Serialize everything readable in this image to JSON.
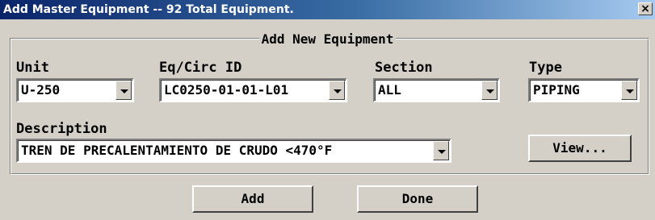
{
  "window": {
    "title": "Add Master Equipment -- 92 Total Equipment.",
    "close_glyph": "×"
  },
  "group": {
    "legend": "Add New Equipment"
  },
  "fields": {
    "unit": {
      "label": "Unit",
      "value": "U-250"
    },
    "eq_circ_id": {
      "label": "Eq/Circ ID",
      "value": "LC0250-01-01-L01"
    },
    "section": {
      "label": "Section",
      "value": "ALL"
    },
    "type": {
      "label": "Type",
      "value": "PIPING"
    },
    "description": {
      "label": "Description",
      "value": "TREN DE PRECALENTAMIENTO DE CRUDO <470°F"
    }
  },
  "buttons": {
    "view": "View...",
    "add": "Add",
    "done": "Done"
  },
  "icons": {
    "dropdown": "chevron-down-icon",
    "close": "close-icon"
  },
  "colors": {
    "title_start": "#0a246a",
    "title_end": "#a6caf0",
    "face": "#d4d0c8"
  }
}
